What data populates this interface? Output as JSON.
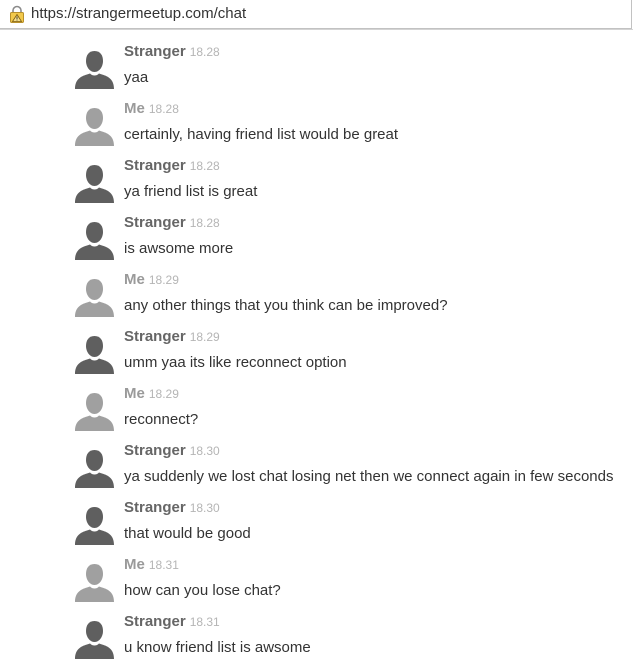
{
  "browser": {
    "url_scheme": "https://",
    "url_host": "strangermeetup.com/chat",
    "lock_icon": "lock-warning-icon"
  },
  "colors": {
    "stranger_avatar": "#5f5f5f",
    "me_avatar": "#a0a0a0",
    "text": "#333333",
    "timestamp": "#b5b5b5"
  },
  "messages": [
    {
      "sender": "Stranger",
      "time": "18.28",
      "text": "yaa",
      "is_me": false
    },
    {
      "sender": "Me",
      "time": "18.28",
      "text": "certainly, having friend list would be great",
      "is_me": true
    },
    {
      "sender": "Stranger",
      "time": "18.28",
      "text": "ya friend list is great",
      "is_me": false
    },
    {
      "sender": "Stranger",
      "time": "18.28",
      "text": "is awsome more",
      "is_me": false
    },
    {
      "sender": "Me",
      "time": "18.29",
      "text": "any other things that you think can be improved?",
      "is_me": true
    },
    {
      "sender": "Stranger",
      "time": "18.29",
      "text": "umm yaa its like reconnect option",
      "is_me": false
    },
    {
      "sender": "Me",
      "time": "18.29",
      "text": "reconnect?",
      "is_me": true
    },
    {
      "sender": "Stranger",
      "time": "18.30",
      "text": "ya suddenly we lost chat losing net then we connect again in few seconds",
      "is_me": false
    },
    {
      "sender": "Stranger",
      "time": "18.30",
      "text": "that would be good",
      "is_me": false
    },
    {
      "sender": "Me",
      "time": "18.31",
      "text": "how can you lose chat?",
      "is_me": true
    },
    {
      "sender": "Stranger",
      "time": "18.31",
      "text": "u know friend list is awsome",
      "is_me": false
    }
  ]
}
